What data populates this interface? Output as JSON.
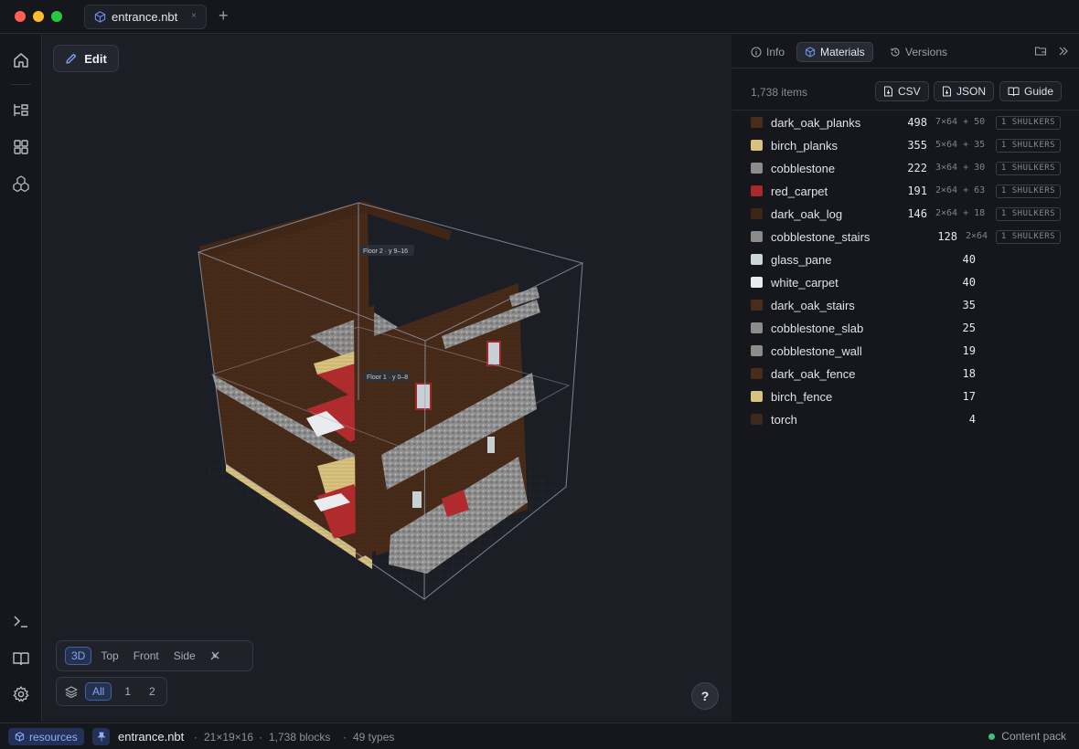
{
  "window": {
    "tab_title": "entrance.nbt",
    "tab_close": "×",
    "new_tab": "+"
  },
  "viewport": {
    "edit_label": "Edit",
    "floor_labels": [
      "Floor 2 · y 9–16",
      "Floor 1 · y 0–8"
    ],
    "view_modes": [
      "3D",
      "Top",
      "Front",
      "Side"
    ],
    "active_view": "3D",
    "layers": [
      "All",
      "1",
      "2"
    ],
    "active_layer": "All",
    "help_label": "?"
  },
  "panel": {
    "tabs": [
      "Info",
      "Materials",
      "Versions"
    ],
    "active_tab": "Materials",
    "item_count": "1,738 items",
    "export_buttons": [
      "CSV",
      "JSON",
      "Guide"
    ],
    "materials": [
      {
        "name": "dark_oak_planks",
        "count": "498",
        "stacks": "7×64 + 50",
        "shulkers": "1 SHULKERS",
        "color": "#4a2c1a"
      },
      {
        "name": "birch_planks",
        "count": "355",
        "stacks": "5×64 + 35",
        "shulkers": "1 SHULKERS",
        "color": "#d8c27e"
      },
      {
        "name": "cobblestone",
        "count": "222",
        "stacks": "3×64 + 30",
        "shulkers": "1 SHULKERS",
        "color": "#8c8c8c"
      },
      {
        "name": "red_carpet",
        "count": "191",
        "stacks": "2×64 + 63",
        "shulkers": "1 SHULKERS",
        "color": "#a8292a"
      },
      {
        "name": "dark_oak_log",
        "count": "146",
        "stacks": "2×64 + 18",
        "shulkers": "1 SHULKERS",
        "color": "#3d2616"
      },
      {
        "name": "cobblestone_stairs",
        "count": "128",
        "stacks": "2×64",
        "shulkers": "1 SHULKERS",
        "color": "#8a8a8a"
      },
      {
        "name": "glass_pane",
        "count": "40",
        "stacks": "",
        "shulkers": "",
        "color": "#c9d6dc"
      },
      {
        "name": "white_carpet",
        "count": "40",
        "stacks": "",
        "shulkers": "",
        "color": "#e9ecef"
      },
      {
        "name": "dark_oak_stairs",
        "count": "35",
        "stacks": "",
        "shulkers": "",
        "color": "#4a2c1a"
      },
      {
        "name": "cobblestone_slab",
        "count": "25",
        "stacks": "",
        "shulkers": "",
        "color": "#8c8c8c"
      },
      {
        "name": "cobblestone_wall",
        "count": "19",
        "stacks": "",
        "shulkers": "",
        "color": "#8c8c8c"
      },
      {
        "name": "dark_oak_fence",
        "count": "18",
        "stacks": "",
        "shulkers": "",
        "color": "#4a2c1a"
      },
      {
        "name": "birch_fence",
        "count": "17",
        "stacks": "",
        "shulkers": "",
        "color": "#d8c27e"
      },
      {
        "name": "torch",
        "count": "4",
        "stacks": "",
        "shulkers": "",
        "color": "#3b2a1c"
      }
    ]
  },
  "status": {
    "collection": "resources",
    "file": "entrance.nbt",
    "dimensions": "21×19×16",
    "blocks": "1,738 blocks",
    "types": "49 types",
    "pack": "Content pack",
    "sep": "·"
  }
}
